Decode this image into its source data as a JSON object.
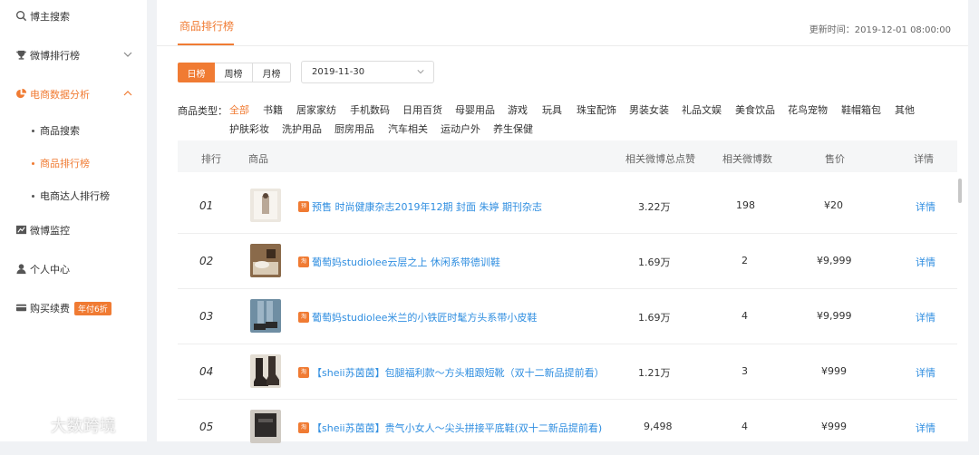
{
  "sidebar": {
    "items": [
      {
        "label": "博主搜索",
        "icon": "search-icon"
      },
      {
        "label": "微博排行榜",
        "icon": "trophy-icon"
      },
      {
        "label": "电商数据分析",
        "icon": "pie-chart-icon"
      },
      {
        "label": "微博监控",
        "icon": "line-chart-icon"
      },
      {
        "label": "个人中心",
        "icon": "user-icon"
      },
      {
        "label": "购买续费",
        "icon": "card-icon"
      }
    ],
    "subitems": [
      {
        "label": "商品搜索"
      },
      {
        "label": "商品排行榜"
      },
      {
        "label": "电商达人排行榜"
      }
    ],
    "badge": "年付6折"
  },
  "main": {
    "tab_title": "商品排行榜",
    "updated": "更新时间：2019-12-01 08:00:00",
    "periods": [
      "日榜",
      "周榜",
      "月榜"
    ],
    "date": "2019-11-30",
    "category_label": "商品类型：",
    "categories": [
      "全部",
      "书籍",
      "居家家纺",
      "手机数码",
      "日用百货",
      "母婴用品",
      "游戏",
      "玩具",
      "珠宝配饰",
      "男装女装",
      "礼品文娱",
      "美食饮品",
      "花鸟宠物",
      "鞋帽箱包",
      "其他",
      "护肤彩妆",
      "洗护用品",
      "厨房用品",
      "汽车相关",
      "运动户外",
      "养生保健"
    ]
  },
  "table": {
    "headers": [
      "排行",
      "商品",
      "相关微博总点赞",
      "相关微博数",
      "售价",
      "详情"
    ],
    "rows": [
      {
        "rank": "01",
        "tag": "预售",
        "name": "预售 时尚健康杂志2019年12期 封面 朱婷 期刊杂志",
        "likes": "3.22万",
        "posts": "198",
        "price": "¥20",
        "detail": "详情"
      },
      {
        "rank": "02",
        "tag": "淘",
        "name": "葡萄妈studiolee云层之上 休闲系带德训鞋",
        "likes": "1.69万",
        "posts": "2",
        "price": "¥9,999",
        "detail": "详情"
      },
      {
        "rank": "03",
        "tag": "淘",
        "name": "葡萄妈studiolee米兰的小铁匠时髦方头系带小皮鞋",
        "likes": "1.69万",
        "posts": "4",
        "price": "¥9,999",
        "detail": "详情"
      },
      {
        "rank": "04",
        "tag": "淘",
        "name": "【sheii苏茵茵】包腿福利款～方头粗跟短靴（双十二新品提前看）",
        "likes": "1.21万",
        "posts": "3",
        "price": "¥999",
        "detail": "详情"
      },
      {
        "rank": "05",
        "tag": "淘",
        "name": "【sheii苏茵茵】贵气小女人～尖头拼接平底鞋(双十二新品提前看)",
        "likes": "9,498",
        "posts": "4",
        "price": "¥999",
        "detail": "详情"
      }
    ]
  },
  "watermark": "大数跨境",
  "colors": {
    "accent": "#f07b33",
    "link": "#2f8ee0"
  }
}
